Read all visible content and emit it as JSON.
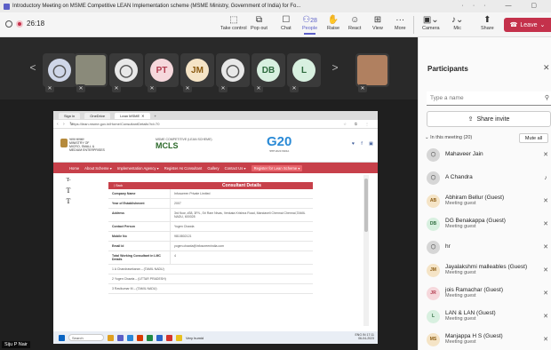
{
  "window": {
    "title": "Introductory Meeting on MSME Competitive LEAN Implementation scheme (MSME Ministry, Government of India) for Fo...",
    "controls": "··· — ▢"
  },
  "meeting": {
    "timer": "26:18"
  },
  "toolbar": {
    "take_control": "Take control",
    "pop_out": "Pop out",
    "chat": "Chat",
    "people": "People",
    "people_count": "28",
    "raise": "Raise",
    "react": "React",
    "view": "View",
    "more": "More",
    "camera": "Camera",
    "mic": "Mic",
    "share": "Share",
    "leave": "Leave"
  },
  "strip": {
    "tiles": [
      {
        "initials": "",
        "bg": "#cfd6e8",
        "fg": "#555",
        "kind": "avatar"
      },
      {
        "initials": "",
        "bg": "#8a8a7a",
        "fg": "#fff",
        "kind": "photo"
      },
      {
        "initials": "",
        "bg": "#e8e8e8",
        "fg": "#555",
        "kind": "avatar"
      },
      {
        "initials": "PT",
        "bg": "#f6d8dc",
        "fg": "#b13b4e",
        "kind": "initials"
      },
      {
        "initials": "JM",
        "bg": "#f5e4c6",
        "fg": "#8a5a10",
        "kind": "initials"
      },
      {
        "initials": "",
        "bg": "#e8e8e8",
        "fg": "#555",
        "kind": "avatar"
      },
      {
        "initials": "DB",
        "bg": "#d8f0e0",
        "fg": "#2e6b3e",
        "kind": "initials"
      },
      {
        "initials": "L",
        "bg": "#d8f0e0",
        "fg": "#2e6b3e",
        "kind": "initials"
      },
      {
        "initials": "",
        "bg": "#b08060",
        "fg": "#fff",
        "kind": "photo"
      }
    ],
    "presenter_name": "Siju P Nair"
  },
  "shared": {
    "tabs": [
      "Sign in",
      "OneDrive",
      "Lean MSME"
    ],
    "url": "https://lean.msme.gov.in/Home/ConsultantDetails?id=70",
    "ministry": [
      "भारत सरकार",
      "MINISTRY OF",
      "MICRO, SMALL &",
      "MEDIUM ENTERPRISES"
    ],
    "mcls_sub": "MSME COMPETITIVE (LEAN SCHEME)",
    "mcls": "MCLS",
    "g20": "G20",
    "g20_sub": "भारत 2023 INDIA",
    "nav": [
      "Home",
      "About Scheme ▾",
      "Implementation Agency ▾",
      "Register As Consultant",
      "Gallery",
      "Contact Us ▾",
      "Register for Lean Scheme ▾"
    ],
    "left_glyphs": [
      "T-",
      "T",
      "T"
    ],
    "table": {
      "back": "⟨ Back",
      "title": "Consultant Details",
      "rows": [
        {
          "k": "Company Name",
          "v": "Infoscreen Private Limited"
        },
        {
          "k": "Year of Establishment",
          "v": "2007"
        },
        {
          "k": "Address",
          "v": "3rd floor, #38, 3P/L, Sri Ram Nivas, Venkata Krishna Road, Mandaveli Chennai Chennai,TAMIL NADU, 600028"
        },
        {
          "k": "Contact Person",
          "v": "Yogen Chawla"
        },
        {
          "k": "Mobile No",
          "v": "9810802121"
        },
        {
          "k": "Email id",
          "v": "yogen.chawla@infoscreenindia.com"
        },
        {
          "k": "Total Working Consultant in LMC Details",
          "v": "4"
        }
      ],
      "consultants": [
        "1  A Chandrasekaran – (TAMIL NADU)",
        "2  Yogen Chawla – (UTTAR PRADESH)",
        "3  Ravikumar M – (TAMIL NADU)"
      ]
    },
    "taskbar": {
      "search": "Search",
      "weather": "Very humid",
      "lang": "ENG IN",
      "time": "17:11",
      "date": "06-04-2023"
    }
  },
  "panel": {
    "title": "Participants",
    "search_placeholder": "Type a name",
    "share_invite": "Share invite",
    "section": "In this meeting (20)",
    "mute_all": "Mute all",
    "people": [
      {
        "name": "Mahaveer Jain",
        "sub": "",
        "initials": "",
        "bg": "#d6d6d6",
        "fg": "#555",
        "mic": "muted"
      },
      {
        "name": "A Chandra",
        "sub": "",
        "initials": "",
        "bg": "#d6d6d6",
        "fg": "#555",
        "mic": "on"
      },
      {
        "name": "Abhiram Bellur (Guest)",
        "sub": "Meeting guest",
        "initials": "AB",
        "bg": "#f5e4c6",
        "fg": "#8a5a10",
        "mic": "muted"
      },
      {
        "name": "DG Benakappa (Guest)",
        "sub": "Meeting guest",
        "initials": "DB",
        "bg": "#d8f0e0",
        "fg": "#2e6b3e",
        "mic": "muted"
      },
      {
        "name": "hr",
        "sub": "",
        "initials": "",
        "bg": "#d6d6d6",
        "fg": "#555",
        "mic": "muted"
      },
      {
        "name": "Jayalakshmi malleables (Guest)",
        "sub": "Meeting guest",
        "initials": "JM",
        "bg": "#f5e4c6",
        "fg": "#8a5a10",
        "mic": "muted"
      },
      {
        "name": "jois Ramachar (Guest)",
        "sub": "Meeting guest",
        "initials": "JR",
        "bg": "#f6d8dc",
        "fg": "#b13b4e",
        "mic": "muted"
      },
      {
        "name": "LAN & LAN (Guest)",
        "sub": "Meeting guest",
        "initials": "L",
        "bg": "#d8f0e0",
        "fg": "#2e6b3e",
        "mic": "muted"
      },
      {
        "name": "Manjappa H S (Guest)",
        "sub": "Meeting guest",
        "initials": "MS",
        "bg": "#f5e4c6",
        "fg": "#8a5a10",
        "mic": "muted"
      }
    ]
  }
}
